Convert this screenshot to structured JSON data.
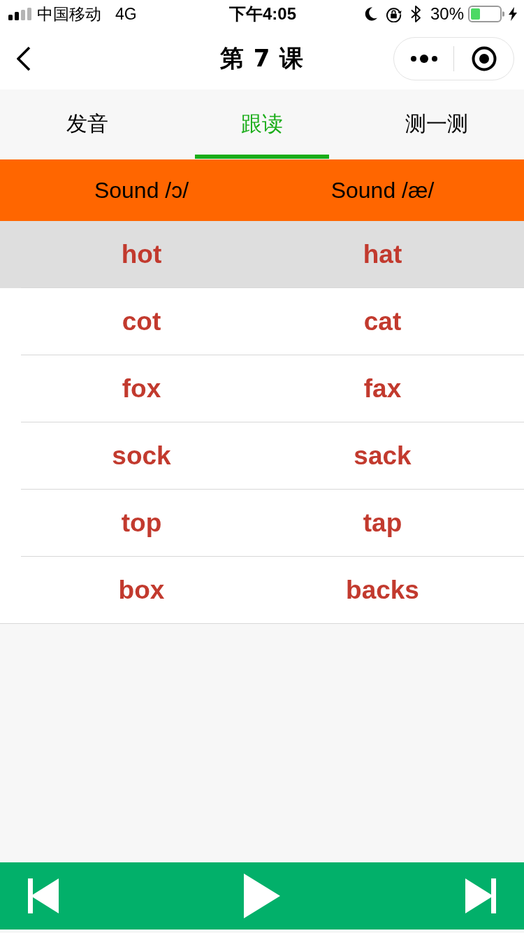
{
  "status_bar": {
    "carrier": "中国移动",
    "network": "4G",
    "time": "下午4:05",
    "battery": "30%"
  },
  "nav_bar": {
    "title": "第 7 课"
  },
  "tabs": [
    {
      "label": "发音",
      "selected": false
    },
    {
      "label": "跟读",
      "selected": true
    },
    {
      "label": "测一测",
      "selected": false
    }
  ],
  "table": {
    "columns": [
      "Sound /ɔ/",
      "Sound /æ/"
    ],
    "rows": [
      {
        "cells": [
          "hot",
          "hat"
        ],
        "selected": true
      },
      {
        "cells": [
          "cot",
          "cat"
        ],
        "selected": false
      },
      {
        "cells": [
          "fox",
          "fax"
        ],
        "selected": false
      },
      {
        "cells": [
          "sock",
          "sack"
        ],
        "selected": false
      },
      {
        "cells": [
          "top",
          "tap"
        ],
        "selected": false
      },
      {
        "cells": [
          "box",
          "backs"
        ],
        "selected": false
      }
    ]
  }
}
